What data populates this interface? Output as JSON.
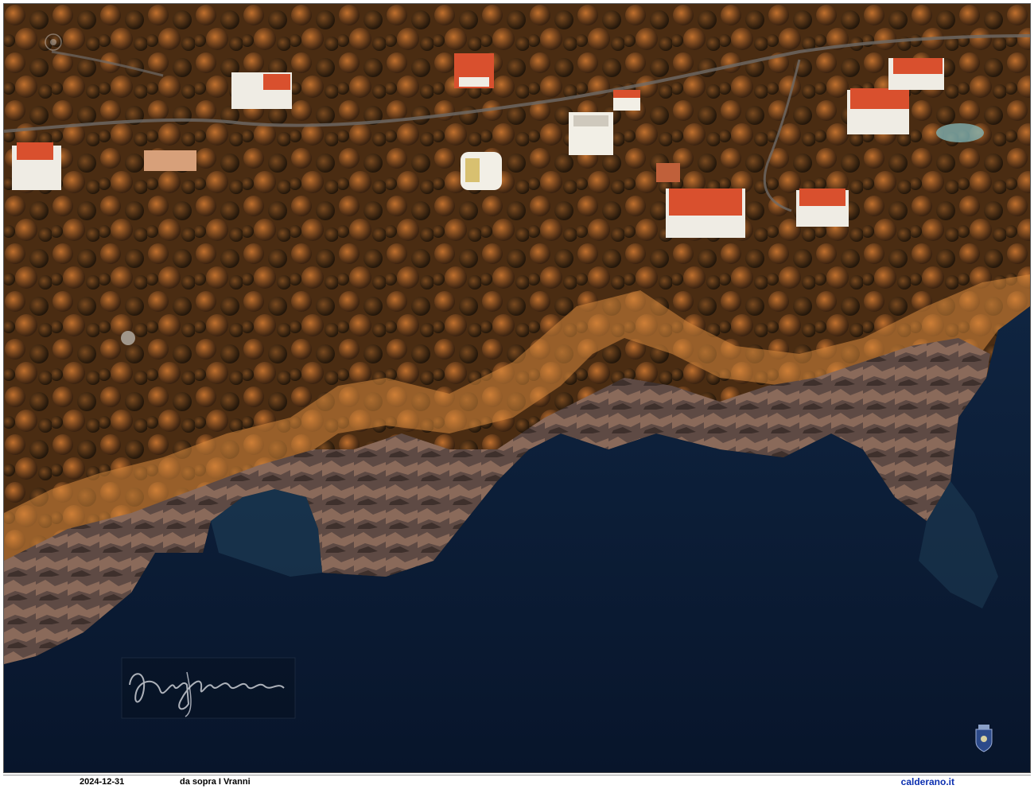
{
  "photo": {
    "subject": "aerial-coastline-photo",
    "colors": {
      "sea_deep": "#0b1a33",
      "sea_shallow": "#1d3a55",
      "forest_dark": "#3a2410",
      "forest_lit": "#b5642a",
      "rock": "#7a6a62",
      "rock_lit": "#e0a060",
      "roof": "#d9502e",
      "wall": "#f2efe6"
    }
  },
  "signature": {
    "text": "Luigi Calderano"
  },
  "caption": {
    "date": "2024-12-31",
    "title": "da sopra I Vranni",
    "site": "calderano.it"
  }
}
